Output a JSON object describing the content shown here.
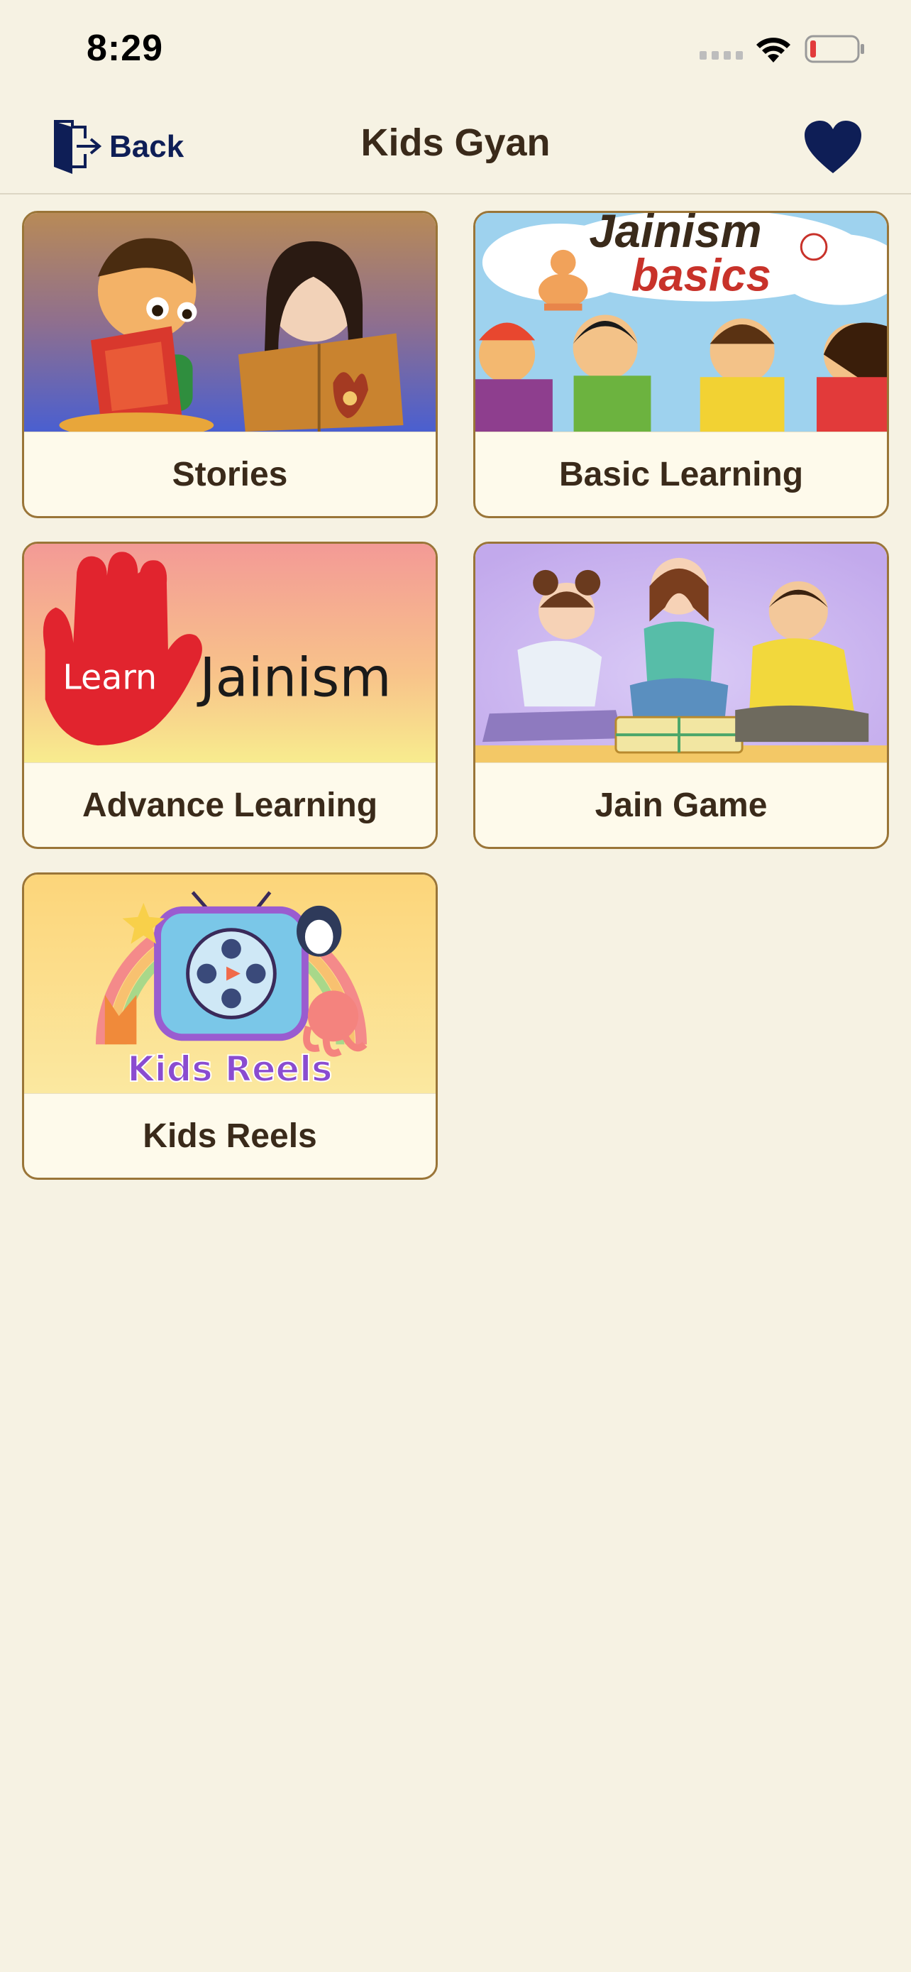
{
  "status_bar": {
    "time": "8:29"
  },
  "nav": {
    "back_label": "Back",
    "title": "Kids Gyan",
    "heart_color": "#0E1E56"
  },
  "categories": [
    {
      "label": "Stories",
      "image_icon": "kids-reading-illustration"
    },
    {
      "label": "Basic Learning",
      "image_icon": "jainism-basics-illustration",
      "image_text_1": "Jainism",
      "image_text_2": "basics"
    },
    {
      "label": "Advance Learning",
      "image_icon": "learn-jainism-hand-illustration",
      "image_text_1": "Learn",
      "image_text_2": "Jainism"
    },
    {
      "label": "Jain Game",
      "image_icon": "kids-playing-board-game-illustration"
    },
    {
      "label": "Kids Reels",
      "image_icon": "kids-reels-tv-illustration",
      "image_text_1": "Kids Reels"
    }
  ],
  "colors": {
    "background": "#F6F2E3",
    "card_border": "#9A7538",
    "card_fill": "#FEFAEB",
    "accent_navy": "#0E1E56"
  }
}
